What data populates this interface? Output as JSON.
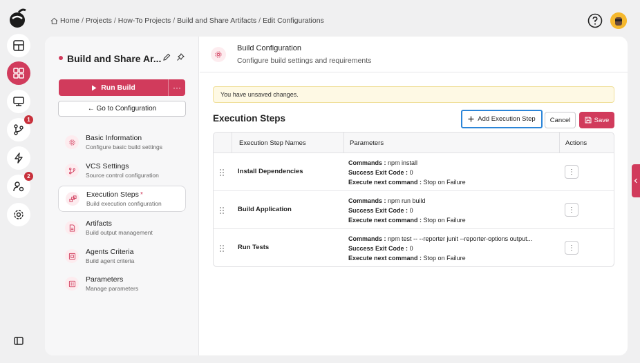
{
  "rail": {
    "badges": {
      "vcs": "1",
      "users": "2"
    },
    "icons": [
      "home-icon",
      "dashboard-icon",
      "monitor-icon",
      "branch-icon",
      "lightning-icon",
      "user-settings-icon",
      "gear-icon",
      "sidebar-toggle-icon"
    ]
  },
  "breadcrumb": [
    "Home",
    "Projects",
    "How-To Projects",
    "Build and Share Artifacts",
    "Edit Configurations"
  ],
  "project": {
    "title": "Build and Share Ar...",
    "run_label": "Run Build",
    "more_label": "···",
    "goto_label": "← Go to Configuration"
  },
  "nav": [
    {
      "label": "Basic Information",
      "sub": "Configure basic build settings",
      "icon": "settings-icon"
    },
    {
      "label": "VCS Settings",
      "sub": "Source control configuration",
      "icon": "branch-icon"
    },
    {
      "label": "Execution Steps",
      "sub": "Build execution configuration",
      "icon": "steps-icon",
      "asterisk": "*"
    },
    {
      "label": "Artifacts",
      "sub": "Build output management",
      "icon": "document-icon"
    },
    {
      "label": "Agents Criteria",
      "sub": "Build agent criteria",
      "icon": "agent-icon"
    },
    {
      "label": "Parameters",
      "sub": "Manage parameters",
      "icon": "sliders-icon"
    }
  ],
  "config": {
    "title": "Build Configuration",
    "subtitle": "Configure build settings and requirements"
  },
  "alert": "You have unsaved changes.",
  "section": {
    "title": "Execution Steps",
    "add_label": "Add Execution Step",
    "cancel_label": "Cancel",
    "save_label": "Save"
  },
  "table": {
    "headers": [
      "Execution Step Names",
      "Parameters",
      "Actions"
    ],
    "param_labels": {
      "commands": "Commands :",
      "exit": "Success Exit Code :",
      "next": "Execute next command :"
    },
    "rows": [
      {
        "name": "Install Dependencies",
        "commands": "npm install",
        "exit": "0",
        "next": "Stop on Failure"
      },
      {
        "name": "Build Application",
        "commands": "npm run build",
        "exit": "0",
        "next": "Stop on Failure"
      },
      {
        "name": "Run Tests",
        "commands": "npm test -- --reporter junit --reporter-options output...",
        "exit": "0",
        "next": "Stop on Failure"
      }
    ]
  },
  "colors": {
    "accent": "#d13b5c",
    "focus": "#2b85d8",
    "alert_bg": "#fef9e4"
  }
}
